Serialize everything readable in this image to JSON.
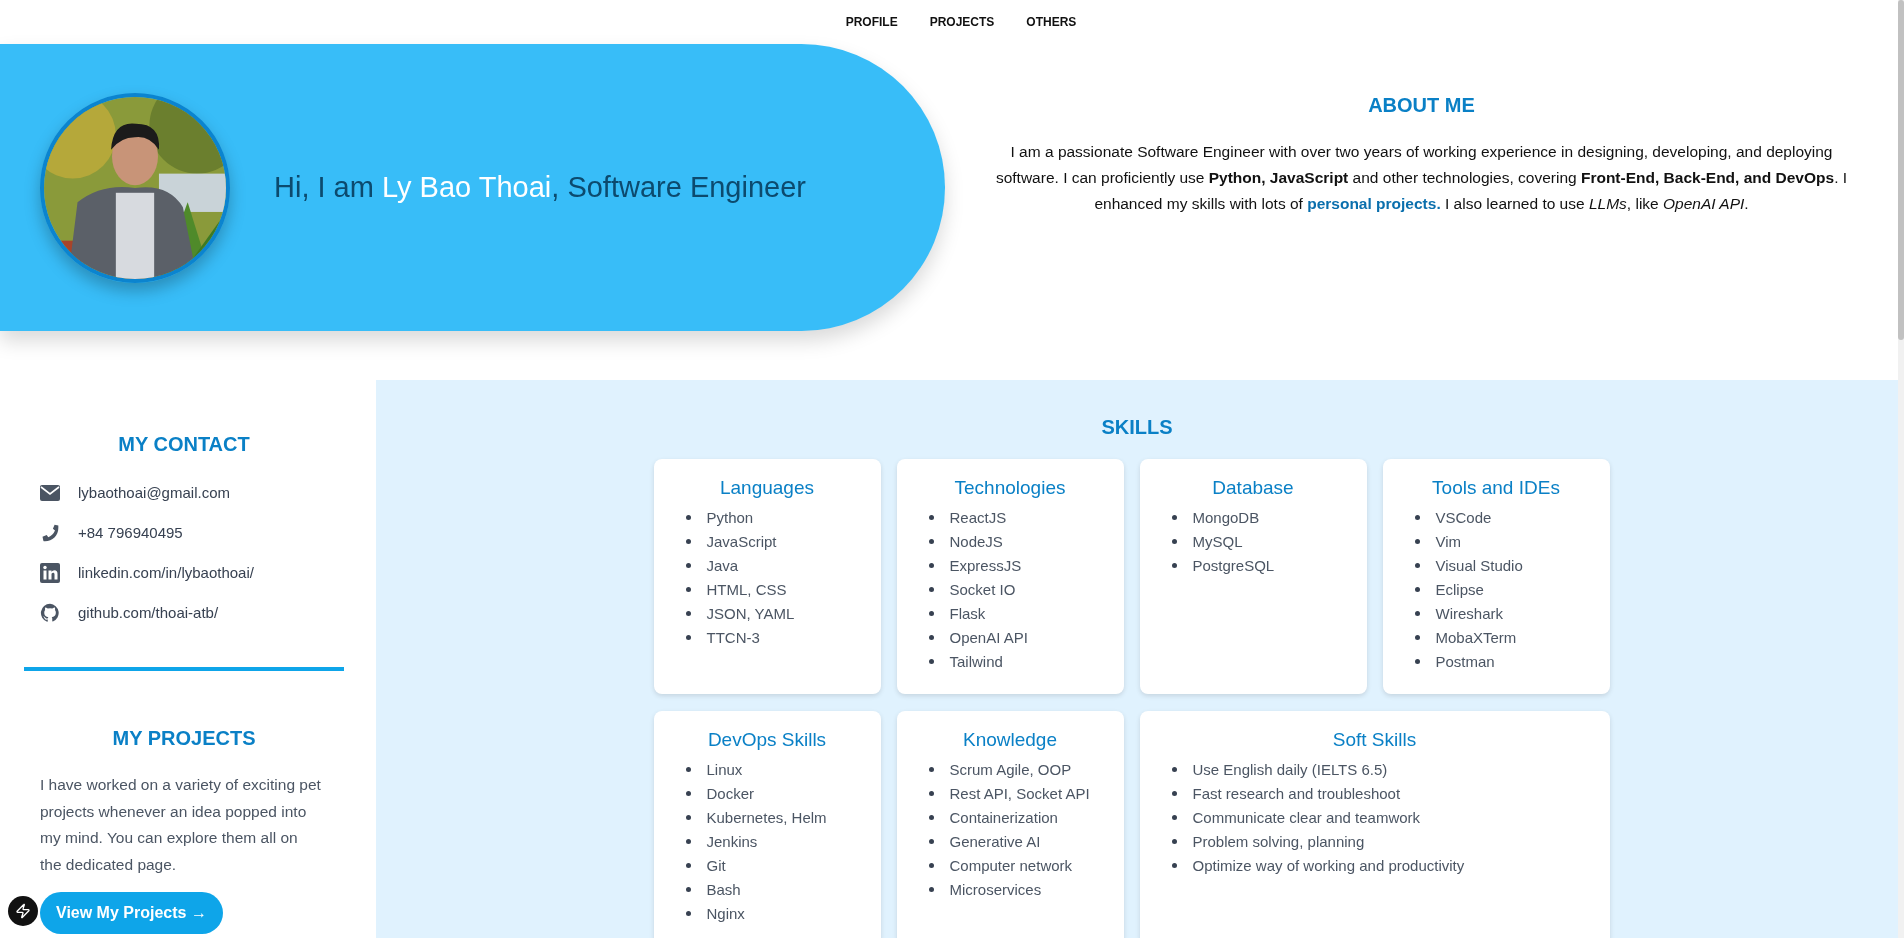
{
  "nav": [
    {
      "label": "PROFILE"
    },
    {
      "label": "PROJECTS"
    },
    {
      "label": "OTHERS"
    }
  ],
  "hero": {
    "kind": "picture",
    "greeting": [
      {
        "text": "Hi, I am ",
        "kind": "plain"
      },
      {
        "text": "Ly Bao Thoai",
        "kind": "name"
      },
      {
        "text": ", Software Engineer",
        "kind": "plain"
      }
    ]
  },
  "about": {
    "title": "ABOUT ME",
    "paragraph": [
      {
        "kind": "text",
        "text": "I am a passionate Software Engineer with over two years of working experience in designing, developing, and deploying software. I can proficiently use **Python, JavaScript** and other technologies, covering **Front-End, Back-End, and DevOps**. I enhanced my skills with lots of "
      },
      {
        "kind": "link",
        "text": "personal projects."
      },
      {
        "kind": "text",
        "text": " I also learned to use *LLMs*, like *OpenAI API*."
      }
    ]
  },
  "contact": {
    "title": "MY CONTACT",
    "items": [
      {
        "kind": "email",
        "text": "lybaothoai@gmail.com"
      },
      {
        "kind": "phone",
        "text": "+84 796940495"
      },
      {
        "kind": "linkedin",
        "text": "linkedin.com/in/lybaothoai/"
      },
      {
        "kind": "github",
        "text": "github.com/thoai-atb/"
      }
    ]
  },
  "projects": {
    "title": "MY PROJECTS",
    "text": "I have worked on a variety of exciting pet projects whenever an idea popped into my mind. You can explore them all on the dedicated page.",
    "button": "View My Projects →"
  },
  "skills": {
    "title": "SKILLS",
    "cards": [
      {
        "kind": "normal",
        "title": "Languages",
        "items": [
          "Python",
          "JavaScript",
          "Java",
          "HTML, CSS",
          "JSON, YAML",
          "TTCN-3"
        ]
      },
      {
        "kind": "normal",
        "title": "Technologies",
        "items": [
          "ReactJS",
          "NodeJS",
          "ExpressJS",
          "Socket IO",
          "Flask",
          "OpenAI API",
          "Tailwind"
        ]
      },
      {
        "kind": "normal",
        "title": "Database",
        "items": [
          "MongoDB",
          "MySQL",
          "PostgreSQL"
        ]
      },
      {
        "kind": "normal",
        "title": "Tools and IDEs",
        "items": [
          "VSCode",
          "Vim",
          "Visual Studio",
          "Eclipse",
          "Wireshark",
          "MobaXTerm",
          "Postman"
        ]
      },
      {
        "kind": "normal",
        "title": "DevOps Skills",
        "items": [
          "Linux",
          "Docker",
          "Kubernetes, Helm",
          "Jenkins",
          "Git",
          "Bash",
          "Nginx"
        ]
      },
      {
        "kind": "normal",
        "title": "Knowledge",
        "items": [
          "Scrum Agile, OOP",
          "Rest API, Socket API",
          "Containerization",
          "Generative AI",
          "Computer network",
          "Microservices"
        ]
      },
      {
        "kind": "wide",
        "title": "Soft Skills",
        "items": [
          "Use English daily (IELTS 6.5)",
          "Fast research and troubleshoot",
          "Communicate clear and teamwork",
          "Problem solving, planning",
          "Optimize way of working and productivity"
        ]
      }
    ]
  }
}
